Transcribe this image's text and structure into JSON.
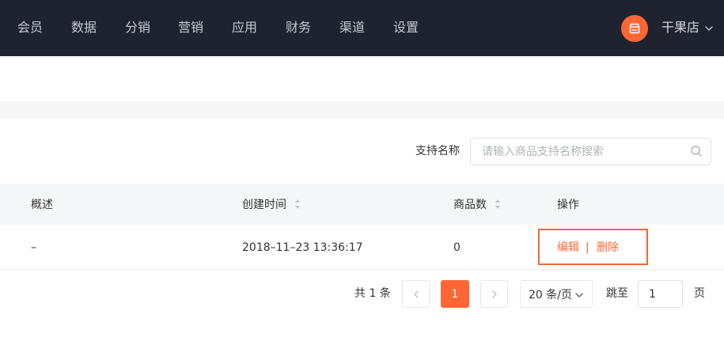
{
  "nav": {
    "items": [
      {
        "label": "会员",
        "name": "nav-item-members"
      },
      {
        "label": "数据",
        "name": "nav-item-data"
      },
      {
        "label": "分销",
        "name": "nav-item-distribution"
      },
      {
        "label": "营销",
        "name": "nav-item-marketing"
      },
      {
        "label": "应用",
        "name": "nav-item-apps"
      },
      {
        "label": "财务",
        "name": "nav-item-finance"
      },
      {
        "label": "渠道",
        "name": "nav-item-channels"
      },
      {
        "label": "设置",
        "name": "nav-item-settings"
      }
    ],
    "shop_name": "干果店",
    "shop_icon": "store-icon"
  },
  "search": {
    "label": "支持名称",
    "placeholder": "请输入商品支持名称搜索",
    "value": ""
  },
  "table": {
    "columns": [
      "概述",
      "创建时间",
      "商品数",
      "操作"
    ],
    "rows": [
      {
        "summary": "–",
        "created_at": "2018–11–23 13:36:17",
        "product_count": "0",
        "actions": {
          "edit": "编辑",
          "separator": "|",
          "delete": "删除"
        }
      }
    ]
  },
  "pagination": {
    "total_text": "共 1 条",
    "current_page": "1",
    "page_size": "20 条/页",
    "jump_label": "跳至",
    "jump_value": "1",
    "page_unit": "页"
  },
  "colors": {
    "accent": "#ff6633",
    "nav_bg": "#1f2330",
    "highlight_border": "#ea6a3a"
  }
}
